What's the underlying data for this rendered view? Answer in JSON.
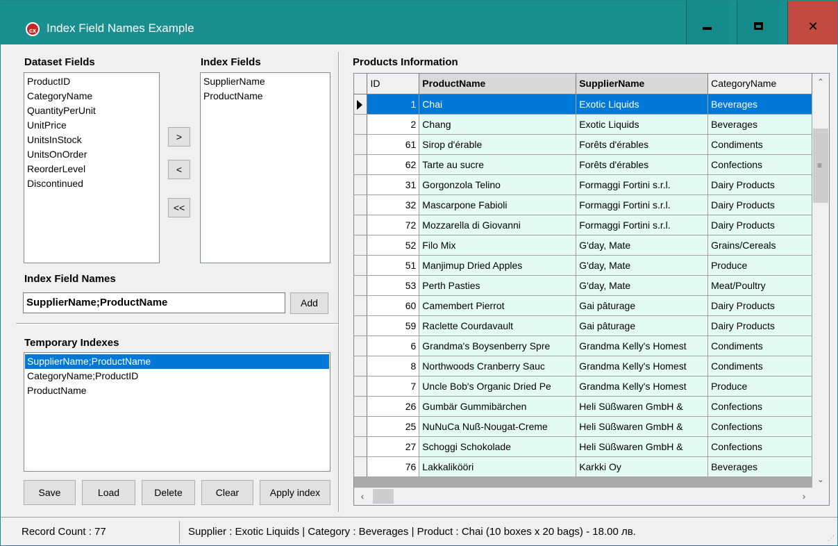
{
  "window": {
    "title": "Index Field Names Example",
    "icon": "app-logo-icon",
    "icon_text": "cx"
  },
  "dataset_fields": {
    "label": "Dataset Fields",
    "items": [
      "ProductID",
      "CategoryName",
      "QuantityPerUnit",
      "UnitPrice",
      "UnitsInStock",
      "UnitsOnOrder",
      "ReorderLevel",
      "Discontinued"
    ]
  },
  "index_fields": {
    "label": "Index Fields",
    "items": [
      "SupplierName",
      "ProductName"
    ]
  },
  "move_buttons": {
    "add": ">",
    "remove": "<",
    "remove_all": "<<"
  },
  "index_field_names": {
    "label": "Index Field Names",
    "value": "SupplierName;ProductName",
    "add_label": "Add"
  },
  "temporary_indexes": {
    "label": "Temporary Indexes",
    "items": [
      "SupplierName;ProductName",
      "CategoryName;ProductID",
      "ProductName"
    ],
    "selected": 0
  },
  "actions": {
    "save": "Save",
    "load": "Load",
    "delete": "Delete",
    "clear": "Clear",
    "apply": "Apply index"
  },
  "products": {
    "label": "Products Information",
    "columns": [
      "ID",
      "ProductName",
      "SupplierName",
      "CategoryName"
    ],
    "rows": [
      [
        "1",
        "Chai",
        "Exotic Liquids",
        "Beverages"
      ],
      [
        "2",
        "Chang",
        "Exotic Liquids",
        "Beverages"
      ],
      [
        "61",
        "Sirop d'érable",
        "Forêts d'érables",
        "Condiments"
      ],
      [
        "62",
        "Tarte au sucre",
        "Forêts d'érables",
        "Confections"
      ],
      [
        "31",
        "Gorgonzola Telino",
        "Formaggi Fortini s.r.l.",
        "Dairy Products"
      ],
      [
        "32",
        "Mascarpone Fabioli",
        "Formaggi Fortini s.r.l.",
        "Dairy Products"
      ],
      [
        "72",
        "Mozzarella di Giovanni",
        "Formaggi Fortini s.r.l.",
        "Dairy Products"
      ],
      [
        "52",
        "Filo Mix",
        "G'day, Mate",
        "Grains/Cereals"
      ],
      [
        "51",
        "Manjimup Dried Apples",
        "G'day, Mate",
        "Produce"
      ],
      [
        "53",
        "Perth Pasties",
        "G'day, Mate",
        "Meat/Poultry"
      ],
      [
        "60",
        "Camembert Pierrot",
        "Gai pâturage",
        "Dairy Products"
      ],
      [
        "59",
        "Raclette Courdavault",
        "Gai pâturage",
        "Dairy Products"
      ],
      [
        "6",
        "Grandma's Boysenberry Spre",
        "Grandma Kelly's Homest",
        "Condiments"
      ],
      [
        "8",
        "Northwoods Cranberry Sauc",
        "Grandma Kelly's Homest",
        "Condiments"
      ],
      [
        "7",
        "Uncle Bob's Organic Dried Pe",
        "Grandma Kelly's Homest",
        "Produce"
      ],
      [
        "26",
        "Gumbär Gummibärchen",
        "Heli Süßwaren GmbH &",
        "Confections"
      ],
      [
        "25",
        "NuNuCa Nuß-Nougat-Creme",
        "Heli Süßwaren GmbH &",
        "Confections"
      ],
      [
        "27",
        "Schoggi Schokolade",
        "Heli Süßwaren GmbH &",
        "Confections"
      ],
      [
        "76",
        "Lakkalikööri",
        "Karkki Oy",
        "Beverages"
      ]
    ],
    "selected_row": 0
  },
  "status": {
    "record_count": "Record Count : 77",
    "info": "Supplier : Exotic Liquids |  Category : Beverages |  Product : Chai (10 boxes x 20 bags) - 18.00 лв."
  }
}
